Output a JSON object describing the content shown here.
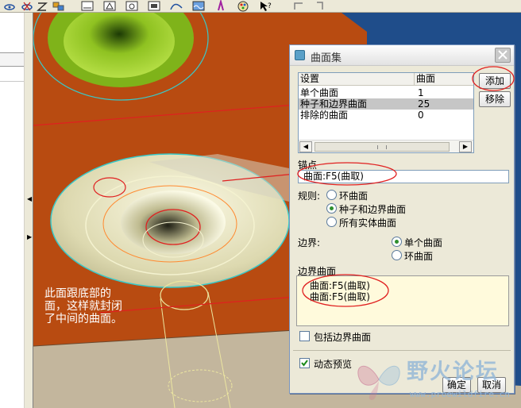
{
  "colors": {
    "plane": "#b84b11",
    "plane_light": "#c3b69d",
    "green_part": "#8fc221",
    "annotation_red": "#e02020",
    "dialog_bg": "#ece9d8",
    "boundary_bg": "#fffadc"
  },
  "toolbar": {
    "icons": [
      "eye-icon",
      "eye-x-icon",
      "z-axis-icon",
      "layers-icon",
      "view-front-icon",
      "view-top-icon",
      "view-side-icon",
      "view-shade-icon",
      "curve-icon",
      "wave-icon",
      "color-icon",
      "palette-icon",
      "select-help-icon",
      "arrow-up-icon",
      "arrow-down-icon"
    ]
  },
  "annotation": {
    "text": "此面跟底部的面，这样就封闭了中间的曲面。"
  },
  "dialog": {
    "title": "曲面集",
    "table": {
      "columns": [
        "设置",
        "曲面"
      ],
      "rows": [
        {
          "label": "单个曲面",
          "value": "1",
          "selected": false
        },
        {
          "label": "种子和边界曲面",
          "value": "25",
          "selected": true
        },
        {
          "label": "排除的曲面",
          "value": "0",
          "selected": false
        }
      ]
    },
    "add_button": "添加",
    "remove_button": "移除",
    "anchor_label": "锚点",
    "anchor_value": "曲面:F5(曲取)",
    "rules_label": "规则:",
    "rules": [
      {
        "label": "环曲面",
        "selected": false
      },
      {
        "label": "种子和边界曲面",
        "selected": true
      },
      {
        "label": "所有实体曲面",
        "selected": false
      }
    ],
    "boundary_label": "边界:",
    "boundary_options": [
      {
        "label": "单个曲面",
        "selected": true
      },
      {
        "label": "环曲面",
        "selected": false
      }
    ],
    "boundary_surfaces_label": "边界曲面",
    "boundary_surfaces": [
      "曲面:F5(曲取)",
      "曲面:F5(曲取)"
    ],
    "include_boundary_label": "包括边界曲面",
    "include_boundary_checked": false,
    "dynamic_preview_label": "动态预览",
    "dynamic_preview_checked": true,
    "ok_button": "确定",
    "cancel_button": "取消"
  },
  "watermark": {
    "text": "野火论坛",
    "url": "www.proewildfire.cn"
  }
}
